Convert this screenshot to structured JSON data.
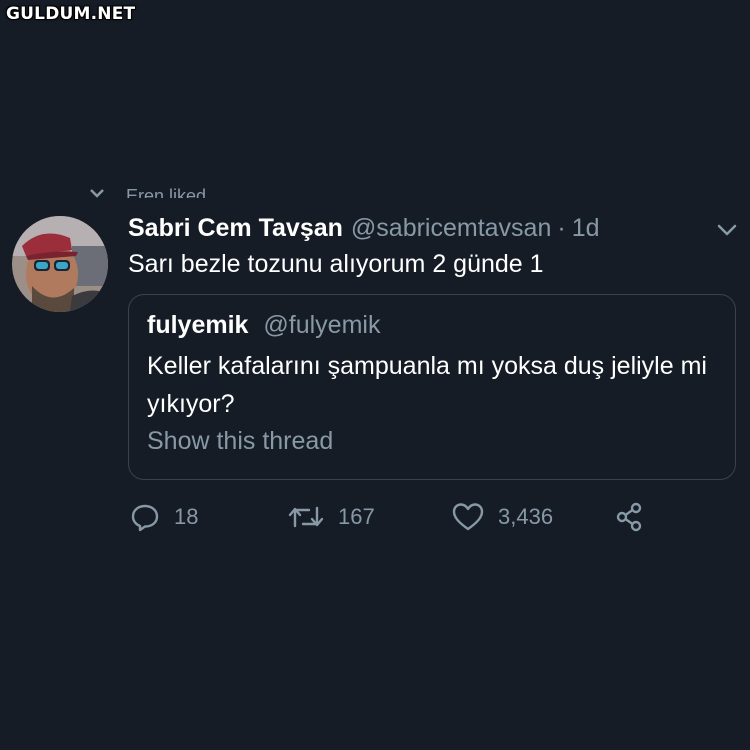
{
  "watermark": "GULDUM.NET",
  "social_context": {
    "text": "Eren liked",
    "icon": "heart-small-icon"
  },
  "tweet": {
    "author_name": "Sabri Cem Tavşan",
    "author_handle": "@sabricemtavsan",
    "separator": "·",
    "time": "1d",
    "text": "Sarı bezle tozunu alıyorum 2 günde 1"
  },
  "quoted_tweet": {
    "author_name": "fulyemik",
    "author_handle": "@fulyemik",
    "text": "Keller kafalarını şampuanla mı yoksa duş jeliyle mi yıkıyor?",
    "show_thread": "Show this thread"
  },
  "actions": {
    "replies": "18",
    "retweets": "167",
    "likes": "3,436"
  },
  "colors": {
    "background": "#151c26",
    "text_primary": "#ffffff",
    "text_secondary": "#8899a6",
    "border": "#38444d"
  }
}
